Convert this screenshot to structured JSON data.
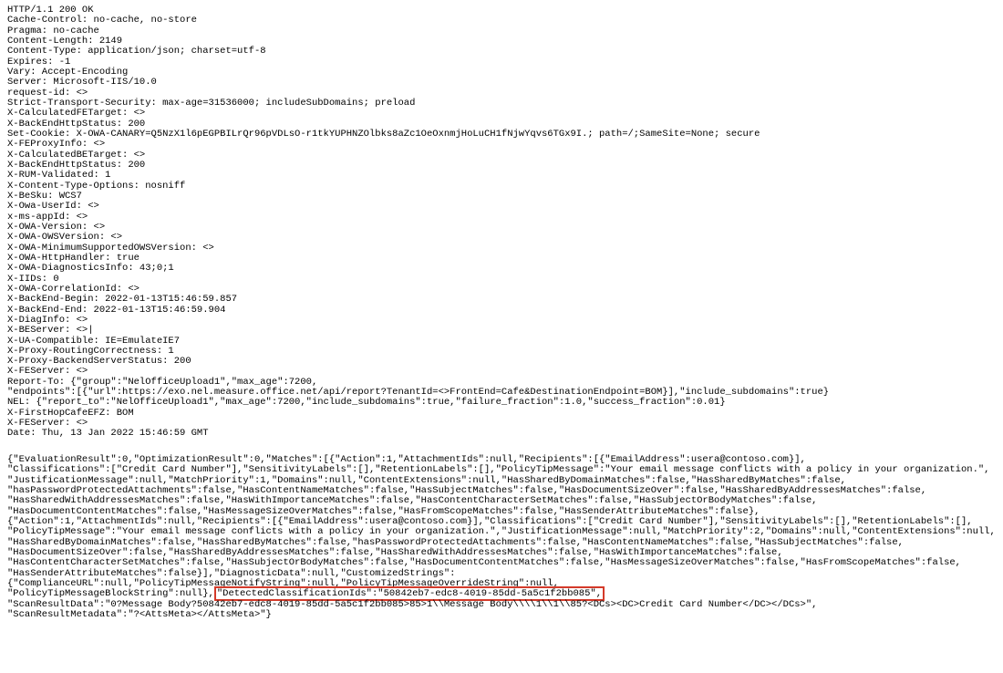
{
  "response": {
    "status_line": "HTTP/1.1 200 OK",
    "headers": [
      "Cache-Control: no-cache, no-store",
      "Pragma: no-cache",
      "Content-Length: 2149",
      "Content-Type: application/json; charset=utf-8",
      "Expires: -1",
      "Vary: Accept-Encoding",
      "Server: Microsoft-IIS/10.0",
      "request-id: <>",
      "Strict-Transport-Security: max-age=31536000; includeSubDomains; preload",
      "X-CalculatedFETarget: <>",
      "X-BackEndHttpStatus: 200",
      "Set-Cookie: X-OWA-CANARY=Q5NzX1l6pEGPBILrQr96pVDLsO-r1tkYUPHNZOlbks8aZc1OeOxnmjHoLuCH1fNjwYqvs6TGx9I.; path=/;SameSite=None; secure",
      "X-FEProxyInfo: <>",
      "X-CalculatedBETarget: <>",
      "X-BackEndHttpStatus: 200",
      "X-RUM-Validated: 1",
      "X-Content-Type-Options: nosniff",
      "X-BeSku: WCS7",
      "X-Owa-UserId: <>",
      "x-ms-appId: <>",
      "X-OWA-Version: <>",
      "X-OWA-OWSVersion: <>",
      "X-OWA-MinimumSupportedOWSVersion: <>",
      "X-OWA-HttpHandler: true",
      "X-OWA-DiagnosticsInfo: 43;0;1",
      "X-IIDs: 0",
      "X-OWA-CorrelationId: <>",
      "X-BackEnd-Begin: 2022-01-13T15:46:59.857",
      "X-BackEnd-End: 2022-01-13T15:46:59.904",
      "X-DiagInfo: <>",
      "X-BEServer: <>|",
      "X-UA-Compatible: IE=EmulateIE7",
      "X-Proxy-RoutingCorrectness: 1",
      "X-Proxy-BackendServerStatus: 200",
      "X-FEServer: <>",
      "Report-To: {\"group\":\"NelOfficeUpload1\",\"max_age\":7200,",
      "\"endpoints\":[{\"url\":https://exo.nel.measure.office.net/api/report?TenantId=<>FrontEnd=Cafe&DestinationEndpoint=BOM}],\"include_subdomains\":true}",
      "NEL: {\"report_to\":\"NelOfficeUpload1\",\"max_age\":7200,\"include_subdomains\":true,\"failure_fraction\":1.0,\"success_fraction\":0.01}",
      "X-FirstHopCafeEFZ: BOM",
      "X-FEServer: <>",
      "Date: Thu, 13 Jan 2022 15:46:59 GMT"
    ],
    "body_pre": "{\"EvaluationResult\":0,\"OptimizationResult\":0,\"Matches\":[{\"Action\":1,\"AttachmentIds\":null,\"Recipients\":[{\"EmailAddress\":usera@contoso.com}],\n\"Classifications\":[\"Credit Card Number\"],\"SensitivityLabels\":[],\"RetentionLabels\":[],\"PolicyTipMessage\":\"Your email message conflicts with a policy in your organization.\",\n\"JustificationMessage\":null,\"MatchPriority\":1,\"Domains\":null,\"ContentExtensions\":null,\"HasSharedByDomainMatches\":false,\"HasSharedByMatches\":false,\n\"hasPasswordProtectedAttachments\":false,\"HasContentNameMatches\":false,\"HasSubjectMatches\":false,\"HasDocumentSizeOver\":false,\"HasSharedByAddressesMatches\":false,\n\"HasSharedWithAddressesMatches\":false,\"HasWithImportanceMatches\":false,\"HasContentCharacterSetMatches\":false,\"HasSubjectOrBodyMatches\":false,\n\"HasDocumentContentMatches\":false,\"HasMessageSizeOverMatches\":false,\"HasFromScopeMatches\":false,\"HasSenderAttributeMatches\":false},\n{\"Action\":1,\"AttachmentIds\":null,\"Recipients\":[{\"EmailAddress\":usera@contoso.com}],\"Classifications\":[\"Credit Card Number\"],\"SensitivityLabels\":[],\"RetentionLabels\":[],\n\"PolicyTipMessage\":\"Your email message conflicts with a policy in your organization.\",\"JustificationMessage\":null,\"MatchPriority\":2,\"Domains\":null,\"ContentExtensions\":null,\n\"HasSharedByDomainMatches\":false,\"HasSharedByMatches\":false,\"hasPasswordProtectedAttachments\":false,\"HasContentNameMatches\":false,\"HasSubjectMatches\":false,\n\"HasDocumentSizeOver\":false,\"HasSharedByAddressesMatches\":false,\"HasSharedWithAddressesMatches\":false,\"HasWithImportanceMatches\":false,\n\"HasContentCharacterSetMatches\":false,\"HasSubjectOrBodyMatches\":false,\"HasDocumentContentMatches\":false,\"HasMessageSizeOverMatches\":false,\"HasFromScopeMatches\":false,\n\"HasSenderAttributeMatches\":false}],\"DiagnosticData\":null,\"CustomizedStrings\":{\"ComplianceURL\":null,\"PolicyTipMessageNotifyString\":null,\"PolicyTipMessageOverrideString\":null,\n\"PolicyTipMessageBlockString\":null},",
    "body_highlight": "\"DetectedClassificationIds\":\"50842eb7-edc8-4019-85dd-5a5c1f2bb085\",",
    "body_post": "\n\"ScanResultData\":\"0?Message Body?50842eb7-edc8-4019-85dd-5a5c1f2bb085>85>1\\\\Message Body\\\\\\\\1\\\\1\\\\85?<DCs><DC>Credit Card Number</DC></DCs>\",\n\"ScanResultMetadata\":\"?<AttsMeta></AttsMeta>\"}"
  }
}
